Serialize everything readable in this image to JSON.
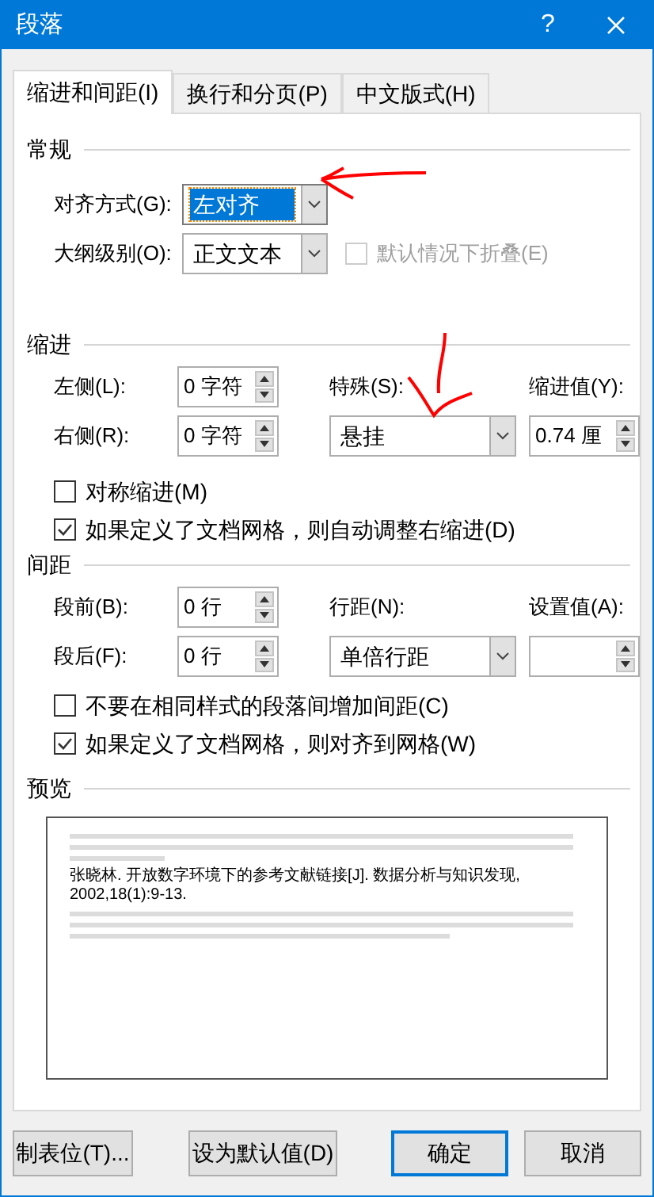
{
  "window": {
    "title": "段落",
    "help": "?"
  },
  "tabs": [
    {
      "label": "缩进和间距(I)",
      "selected": true
    },
    {
      "label": "换行和分页(P)",
      "selected": false
    },
    {
      "label": "中文版式(H)",
      "selected": false
    }
  ],
  "general": {
    "title": "常规",
    "alignment": {
      "label": "对齐方式(G):",
      "value": "左对齐",
      "highlighted": true
    },
    "outline_level": {
      "label": "大纲级别(O):",
      "value": "正文文本",
      "highlighted": false
    },
    "collapse": {
      "label": "默认情况下折叠(E)",
      "checked": false,
      "disabled": true
    }
  },
  "indent": {
    "title": "缩进",
    "left": {
      "label": "左侧(L):",
      "value": "0 字符"
    },
    "right": {
      "label": "右侧(R):",
      "value": "0 字符"
    },
    "special": {
      "label": "特殊(S):",
      "value": "悬挂",
      "highlighted": false
    },
    "by": {
      "label": "缩进值(Y):",
      "value": "0.74 厘"
    },
    "options": [
      {
        "label": "对称缩进(M)",
        "checked": false,
        "disabled": false
      },
      {
        "label": "如果定义了文档网格，则自动调整右缩进(D)",
        "checked": true,
        "disabled": false
      }
    ]
  },
  "spacing": {
    "title": "间距",
    "before": {
      "label": "段前(B):",
      "value": "0 行"
    },
    "after": {
      "label": "段后(F):",
      "value": "0 行"
    },
    "line_spacing": {
      "label": "行距(N):",
      "value": "单倍行距",
      "highlighted": false
    },
    "at": {
      "label": "设置值(A):"
    },
    "options": [
      {
        "label": "不要在相同样式的段落间增加间距(C)",
        "checked": false,
        "disabled": false
      },
      {
        "label": "如果定义了文档网格，则对齐到网格(W)",
        "checked": true,
        "disabled": false
      }
    ]
  },
  "preview": {
    "title": "预览",
    "sample": "张晓林. 开放数字环境下的参考文献链接[J]. 数据分析与知识发现, 2002,18(1):9-13."
  },
  "buttons": [
    {
      "label": "制表位(T)...",
      "kind": "normal"
    },
    {
      "label": "设为默认值(D)",
      "kind": "normal"
    },
    {
      "label": "确定",
      "kind": "default"
    },
    {
      "label": "取消",
      "kind": "normal"
    }
  ]
}
